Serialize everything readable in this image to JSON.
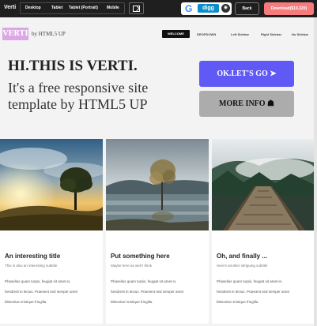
{
  "toolbar": {
    "brand": "Verti",
    "devices": [
      "Desktop",
      "Tablet",
      "Tablet (Portrait)",
      "Mobile"
    ],
    "share": {
      "google": "G",
      "digg": "digg",
      "github": "◉"
    },
    "back_label": "Back",
    "download_label": "Download($19,320)"
  },
  "header": {
    "logo": "VERTI",
    "byline": "by HTML5 UP",
    "nav": [
      "WELCOME",
      "DROPDOWN",
      "Left Sidebar",
      "Right Sidebar",
      "No Sidebar"
    ]
  },
  "banner": {
    "title": "HI.THIS IS VERTI.",
    "subtitle": "It's a free responsive site template by HTML5 UP",
    "primary_button": "OK.LET'S GO ➤",
    "secondary_button": "MORE INFO ☗"
  },
  "cards": [
    {
      "title": "An interesting title",
      "subtitle": "This is also an interesting subtitle",
      "body": [
        "Phasellus quam turpis, feugiat sit amet in,",
        "hendrerit in lectus. Praesent sed semper amet",
        "bibendum tristique fringilla."
      ]
    },
    {
      "title": "Put something here",
      "subtitle": "Maybe here as well I think",
      "body": [
        "Phasellus quam turpis, feugiat sit amet in,",
        "hendrerit in lectus. Praesent sed semper amet",
        "bibendum tristique fringilla."
      ]
    },
    {
      "title": "Oh, and finally ...",
      "subtitle": "Here's another intriguing subtitle",
      "body": [
        "Phasellus quam turpis, feugiat sit amet in,",
        "hendrerit in lectus. Praesent sed semper amet",
        "bibendum tristique fringilla."
      ]
    }
  ],
  "colors": {
    "primary_button": "#6159f6",
    "secondary_button": "#acacac",
    "logo_bg": "#dda6e6",
    "download_button": "#f47c7c"
  }
}
